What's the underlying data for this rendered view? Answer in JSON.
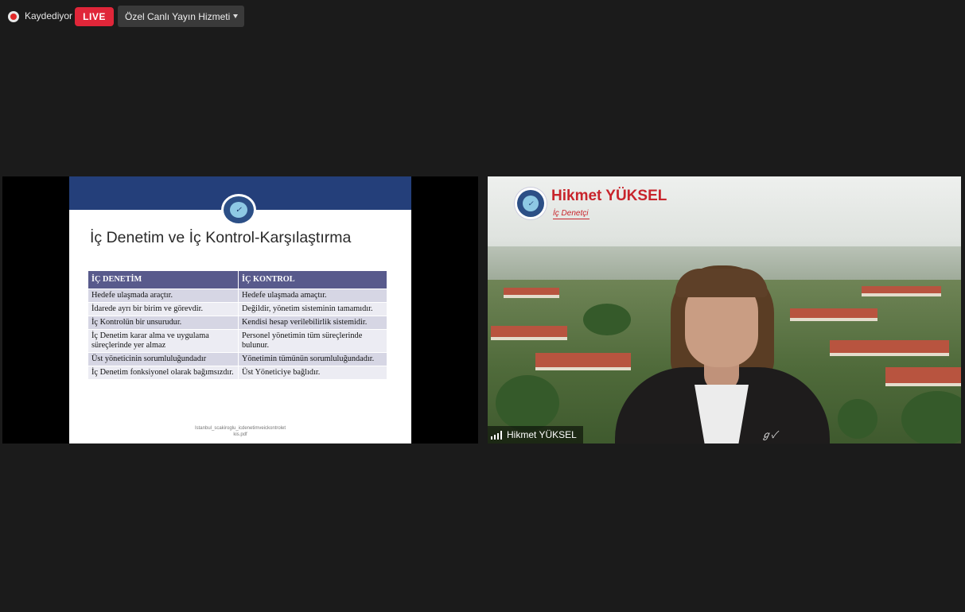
{
  "topbar": {
    "recording_label": "Kaydediyor",
    "live_label": "LIVE",
    "stream_service": "Özel Canlı Yayın Hizmeti"
  },
  "share": {
    "slide": {
      "logo_glyph": "✓",
      "title": "İç Denetim ve İç Kontrol-Karşılaştırma",
      "headers": [
        "İÇ DENETİM",
        "İÇ KONTROL"
      ],
      "rows": [
        [
          "Hedefe ulaşmada araçtır.",
          "Hedefe ulaşmada amaçtır."
        ],
        [
          "İdarede ayrı bir birim ve görevdir.",
          "Değildir, yönetim sisteminin tamamıdır."
        ],
        [
          "İç Kontrolün bir unsurudur.",
          "Kendisi hesap verilebilirlik sistemidir."
        ],
        [
          "İç Denetim karar alma ve uygulama süreçlerinde  yer almaz",
          "Personel yönetimin tüm süreçlerinde bulunur."
        ],
        [
          "Üst yöneticinin sorumluluğundadır",
          "Yönetimin tümünün sorumluluğundadır."
        ],
        [
          "İç Denetim fonksiyonel olarak bağımsızdır.",
          "Üst Yöneticiye bağlıdır."
        ]
      ],
      "source_line1": "Istanbul_scakiroglu_icdenetimveickontrolet",
      "source_line2": "kis.pdf"
    }
  },
  "camera": {
    "brand_logo_glyph": "✓",
    "brand_name": "Hikmet YÜKSEL",
    "brand_role": "İç Denetçi",
    "watermark": "ℊ✓",
    "participant_name": "Hikmet YÜKSEL",
    "signal_icon": "signal-bars-icon"
  },
  "colors": {
    "live": "#e02639",
    "slide_band": "#243f7a",
    "table_header": "#585a8c",
    "brand_red": "#c8242b"
  }
}
